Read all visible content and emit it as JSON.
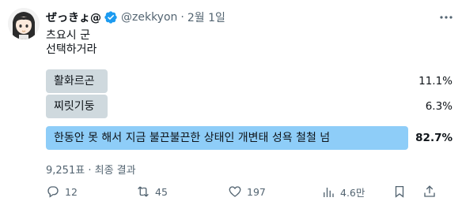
{
  "tweet": {
    "author_name": "ぜっきょ@",
    "handle": "@zekkyon",
    "separator": "·",
    "date": "2월 1일",
    "text_line1": "츠요시 군",
    "text_line2": "선택하거라"
  },
  "poll": {
    "options": [
      {
        "label": "활화르곤",
        "percent_text": "11.1%",
        "percent": 11.1,
        "winner": false
      },
      {
        "label": "찌릿기둥",
        "percent_text": "6.3%",
        "percent": 6.3,
        "winner": false
      },
      {
        "label": "한동안 못 해서 지금 불끈불끈한 상태인 개변태 성욕 철철 넘",
        "percent_text": "82.7%",
        "percent": 82.7,
        "winner": true
      }
    ],
    "votes": "9,251표",
    "separator": "·",
    "status": "최종 결과"
  },
  "actions": {
    "reply_count": "12",
    "retweet_count": "45",
    "like_count": "197",
    "views_count": "4.6만"
  },
  "colors": {
    "bar": "#cfd9de",
    "winner_bar": "#8ecdf8",
    "verified": "#1d9bf0",
    "muted": "#536471"
  }
}
